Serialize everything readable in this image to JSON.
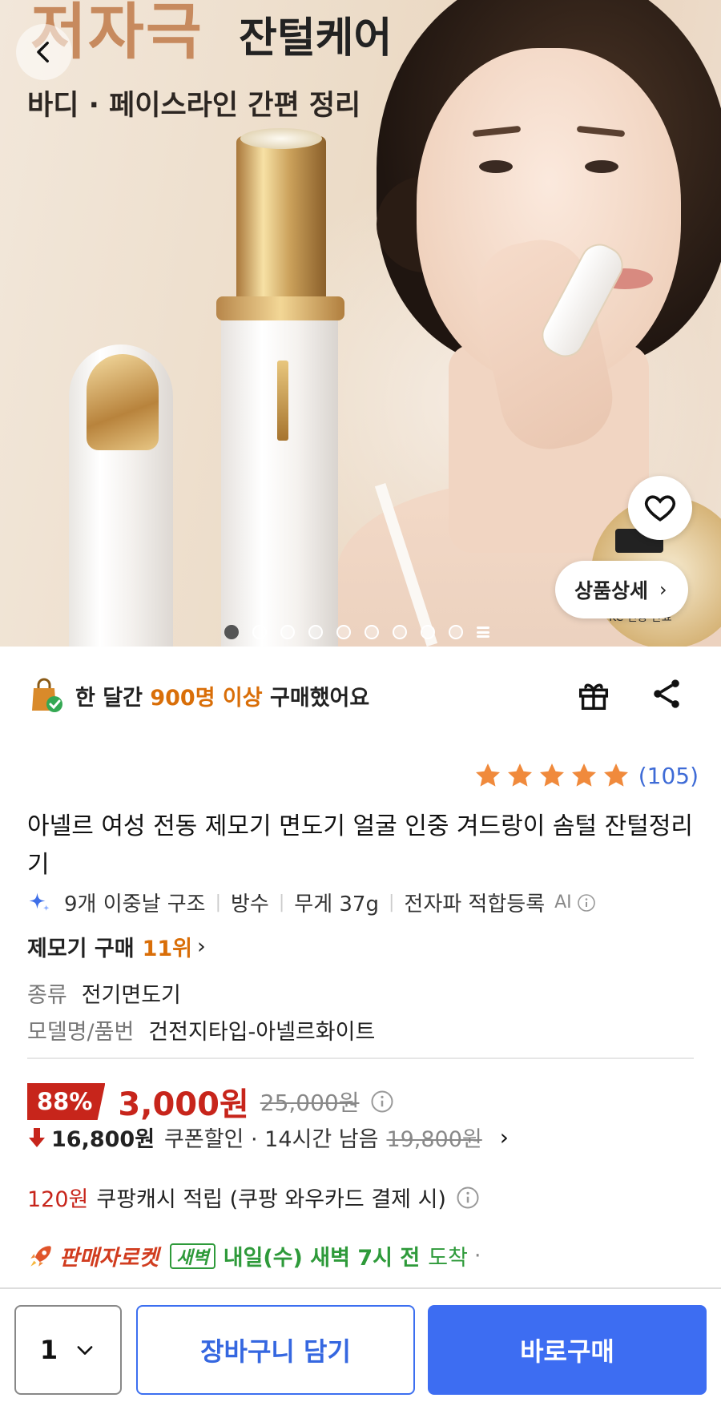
{
  "hero": {
    "headline_accent": "저자극",
    "headline_main": "잔털케어",
    "subheadline": "바디 · 페이스라인 간편 정리",
    "detail_button": "상품상세",
    "seal_text": "KC 인증 완료",
    "dots_total": 9,
    "dots_active": 0
  },
  "social_proof": {
    "prefix": "한 달간 ",
    "highlight": "900명 이상",
    "suffix": " 구매했어요"
  },
  "rating": {
    "stars": 5,
    "count": "(105)"
  },
  "product": {
    "title": "아넬르 여성 전동 제모기 면도기 얼굴 인중 겨드랑이 솜털 잔털정리기",
    "specs": [
      "9개 이중날 구조",
      "방수",
      "무게 37g",
      "전자파 적합등록"
    ],
    "ai_label": "AI",
    "rank_label": "제모기 구매",
    "rank_value": "11위",
    "attributes": [
      {
        "key": "종류",
        "value": "전기면도기"
      },
      {
        "key": "모델명/품번",
        "value": "건전지타입-아넬르화이트"
      }
    ]
  },
  "price": {
    "discount": "88%",
    "sale": "3,000원",
    "original": "25,000원",
    "coupon_amount": "16,800원",
    "coupon_label": "쿠폰할인 · 14시간 남음",
    "coupon_original": "19,800원",
    "cash_amount": "120원",
    "cash_label": "쿠팡캐시 적립 (쿠팡 와우카드 결제 시)"
  },
  "delivery": {
    "rocket_label": "판매자로켓",
    "badge": "새벽",
    "eta": "내일(수) 새벽 7시 전",
    "arrive": "도착",
    "dot": "·"
  },
  "bottom": {
    "quantity": "1",
    "cart_label": "장바구니 담기",
    "buy_label": "바로구매"
  },
  "colors": {
    "accent_orange": "#d96e08",
    "price_red": "#c7251b",
    "link_blue": "#3e6bd6",
    "button_blue": "#3d6df2",
    "dawn_green": "#2e9a3a",
    "star": "#f08a3c"
  }
}
